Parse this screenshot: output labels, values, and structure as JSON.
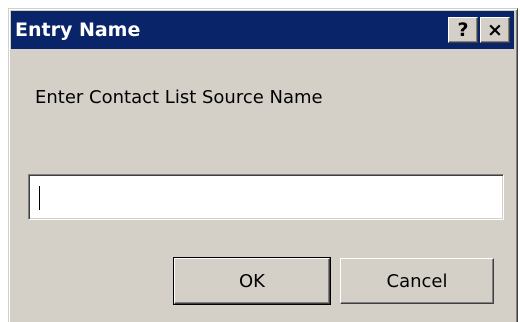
{
  "dialog": {
    "title": "Entry Name",
    "help_label": "?",
    "close_label": "×",
    "prompt": "Enter Contact List Source Name",
    "input_value": ""
  },
  "buttons": {
    "ok_label": "OK",
    "cancel_label": "Cancel"
  },
  "colors": {
    "titlebar": "#0a246a",
    "window_face": "#d4d0c8",
    "title_text": "#ffffff"
  }
}
